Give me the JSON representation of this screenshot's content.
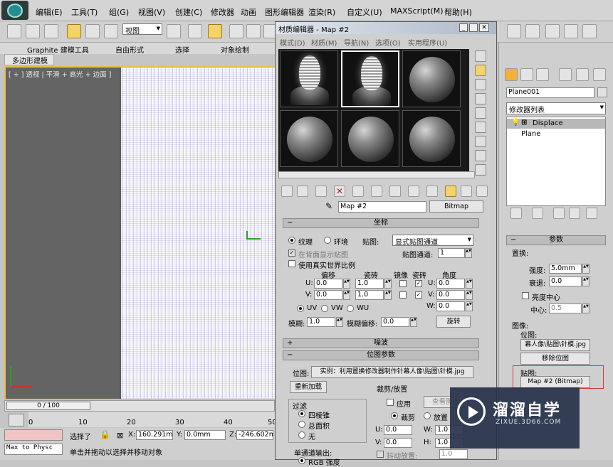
{
  "menu": {
    "items": [
      "编辑(E)",
      "工具(T)",
      "组(G)",
      "视图(V)",
      "创建(C)",
      "修改器",
      "动画",
      "图形编辑器",
      "渲染(R)",
      "自定义(U)",
      "MAXScript(M)",
      "帮助(H)"
    ]
  },
  "toolbar": {
    "view_select": "视图"
  },
  "ribbon": {
    "tabs": [
      "Graphite 建模工具",
      "自由形式",
      "选择",
      "对象绘制"
    ],
    "sub_tab": "多边形建模"
  },
  "viewport": {
    "label": "[ + ] 透视 | 平滑 + 高光 + 边面 ]"
  },
  "timeline": {
    "frame": "0 / 100",
    "ticks": [
      "0",
      "10",
      "20",
      "30",
      "40",
      "50"
    ]
  },
  "status": {
    "max_to_physc": "Max to Physc",
    "selected": "选择了",
    "x_label": "X:",
    "x_value": "160.291mm",
    "y_label": "Y:",
    "y_value": "0.0mm",
    "z_label": "Z:",
    "z_value": "-246.602mm",
    "prompt": "单击并拖动以选择并移动对象"
  },
  "material_editor": {
    "title": "材质编辑器 - Map #2",
    "menu": [
      "模式(D)",
      "材质(M)",
      "导航(N)",
      "选项(O)",
      "实用程序(U)"
    ],
    "map_name": "Map #2",
    "map_type": "Bitmap",
    "coords": {
      "header": "坐标",
      "texture": "纹理",
      "environ": "环境",
      "mapping_label": "贴图:",
      "mapping_value": "显式贴图通道",
      "show_back": "在背面显示贴图",
      "map_channel_label": "贴图通道:",
      "map_channel": "1",
      "real_world": "使用真实世界比例",
      "offset": "偏移",
      "tiling": "瓷砖",
      "mirror": "镜像",
      "tile": "瓷砖",
      "angle": "角度",
      "u_label": "U:",
      "v_label": "V:",
      "w_label": "W:",
      "u_offset": "0.0",
      "v_offset": "0.0",
      "u_tiling": "1.0",
      "v_tiling": "1.0",
      "u_angle": "0.0",
      "v_angle": "0.0",
      "w_angle": "0.0",
      "uv": "UV",
      "vw": "VW",
      "wu": "WU",
      "blur_label": "模糊:",
      "blur": "1.0",
      "blur_offset_label": "模糊偏移:",
      "blur_offset": "0.0",
      "rotate": "旋转"
    },
    "noise": {
      "header": "噪波"
    },
    "bitmap_params": {
      "header": "位图参数",
      "bitmap_label": "位图:",
      "bitmap_path": "实例：利用置换修改器制作针幕人像\\贴图\\针模.jpg",
      "reload": "重新加载",
      "filter": "过滤",
      "pyramidal": "四棱锥",
      "summed": "总面积",
      "none": "无",
      "crop_place": "裁剪/放置",
      "apply": "应用",
      "view_image": "查看图像",
      "crop": "裁剪",
      "place": "放置",
      "u_label": "U:",
      "v_label": "V:",
      "w_label": "W:",
      "h_label": "H:",
      "u_val": "0.0",
      "v_val": "0.0",
      "w_val": "1.0",
      "h_val": "1.0",
      "jitter": "抖动放置:",
      "jitter_val": "1.0",
      "mono_output": "单通道输出:",
      "rgb_intensity": "RGB 强度"
    }
  },
  "command_panel": {
    "object_name": "Plane001",
    "modifier_list": "修改器列表",
    "stack": [
      "Displace",
      "Plane"
    ],
    "params": {
      "header": "参数",
      "displace": "置换:",
      "strength_label": "强度:",
      "strength": "5.0mm",
      "decay_label": "衰退:",
      "decay": "0.0",
      "lum_center": "亮度中心",
      "center_label": "中心:",
      "center": "0.5",
      "image": "图像:",
      "bitmap": "位图:",
      "bitmap_file": "幕人像\\贴图\\针模.jpg",
      "remove_bitmap": "移除位图",
      "map_label": "贴图:",
      "map_button": "Map #2 (Bitmap)"
    }
  },
  "watermark": {
    "brand": "溜溜自学",
    "url": "ZIXUE.3D66.COM"
  },
  "colors": {
    "viewport_border": "#e3c24d",
    "highlight_red": "#d43a3a",
    "active_tool": "#f4d36a"
  }
}
